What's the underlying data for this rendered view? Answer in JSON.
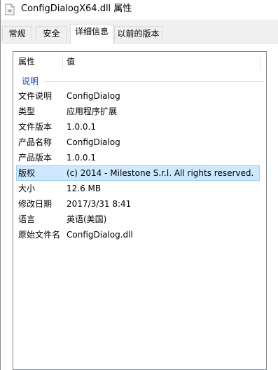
{
  "window": {
    "title": "ConfigDialogX64.dll 属性",
    "file_icon": "file-icon"
  },
  "tabs": [
    {
      "label": "常规"
    },
    {
      "label": "安全"
    },
    {
      "label": "详细信息",
      "active": true
    },
    {
      "label": "以前的版本"
    }
  ],
  "details": {
    "header": {
      "property": "属性",
      "value": "值"
    },
    "group_label": "说明",
    "rows": [
      {
        "property": "文件说明",
        "value": "ConfigDialog"
      },
      {
        "property": "类型",
        "value": "应用程序扩展"
      },
      {
        "property": "文件版本",
        "value": "1.0.0.1"
      },
      {
        "property": "产品名称",
        "value": "ConfigDialog"
      },
      {
        "property": "产品版本",
        "value": "1.0.0.1"
      },
      {
        "property": "版权",
        "value": "(c) 2014 - Milestone S.r.l.  All rights reserved.",
        "selected": true
      },
      {
        "property": "大小",
        "value": "12.6 MB"
      },
      {
        "property": "修改日期",
        "value": "2017/3/31 8:41"
      },
      {
        "property": "语言",
        "value": "英语(美国)"
      },
      {
        "property": "原始文件名",
        "value": "ConfigDialog.dll"
      }
    ]
  },
  "colors": {
    "selection_bg": "#cde8ff",
    "selection_border": "#99d1ff",
    "group_label": "#1f4fa8"
  }
}
